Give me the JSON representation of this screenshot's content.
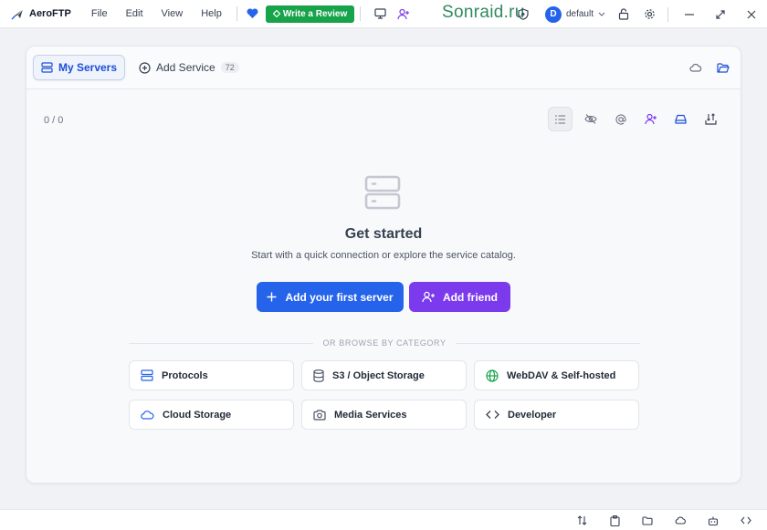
{
  "app": {
    "name": "AeroFTP",
    "menus": [
      "File",
      "Edit",
      "View",
      "Help"
    ],
    "review_label": "Write a Review",
    "watermark": "Sonraid.ru",
    "profile_initial": "D",
    "profile_name": "default"
  },
  "tabs": {
    "my_servers": "My Servers",
    "add_service": "Add Service",
    "service_count": "72"
  },
  "main": {
    "counter": "0 / 0",
    "title": "Get started",
    "subtitle": "Start with a quick connection or explore the service catalog.",
    "add_server_label": "Add your first server",
    "add_friend_label": "Add friend",
    "browse_label": "OR BROWSE BY CATEGORY"
  },
  "categories": [
    {
      "label": "Protocols",
      "icon": "server-icon"
    },
    {
      "label": "S3 / Object Storage",
      "icon": "database-icon"
    },
    {
      "label": "WebDAV & Self-hosted",
      "icon": "globe-icon"
    },
    {
      "label": "Cloud Storage",
      "icon": "cloud-icon"
    },
    {
      "label": "Media Services",
      "icon": "camera-icon"
    },
    {
      "label": "Developer",
      "icon": "code-icon"
    }
  ],
  "colors": {
    "primary": "#2563eb",
    "friend": "#7c3aed",
    "review": "#16a34a",
    "webdav": "#16a34a"
  }
}
